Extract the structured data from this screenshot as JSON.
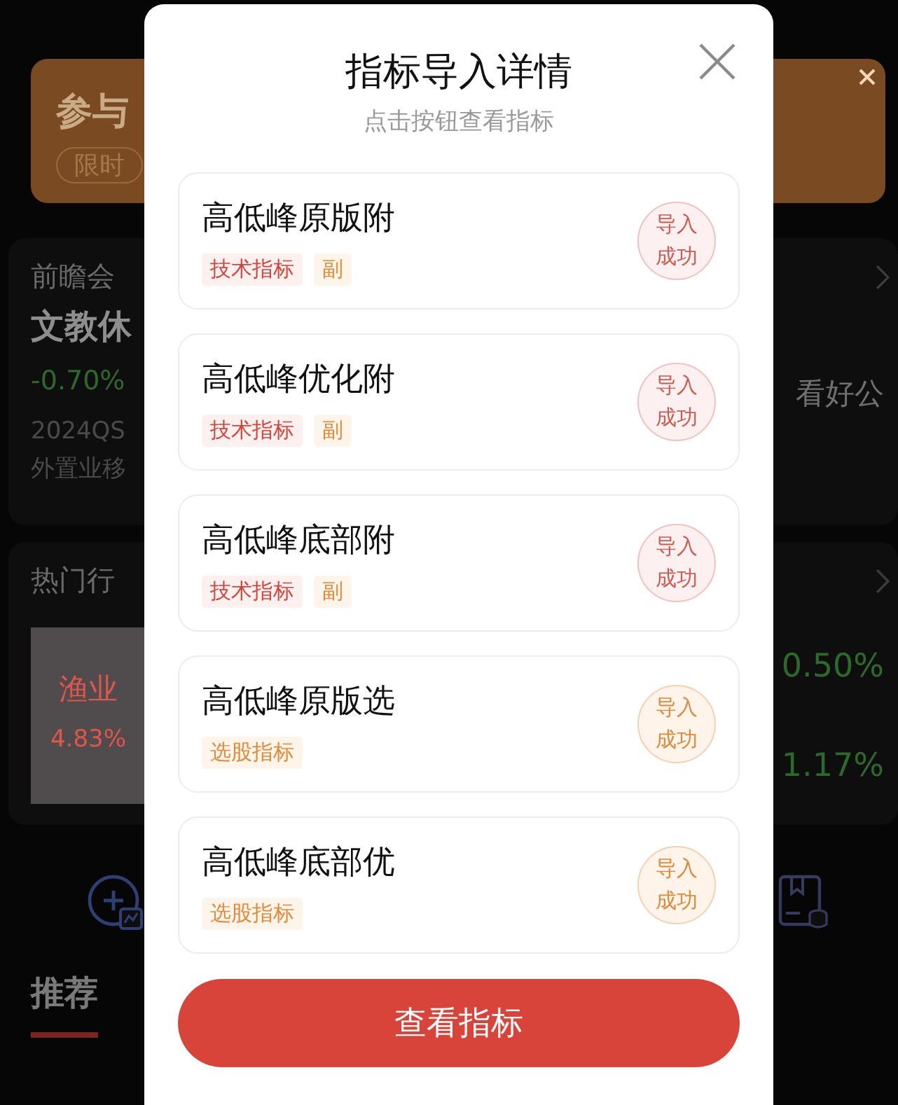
{
  "background": {
    "banner": {
      "title": "参与",
      "tag": "限时"
    },
    "meeting_card": {
      "heading": "前瞻会",
      "name": "文教休",
      "change": "-0.70%",
      "note": "看好公",
      "lines": [
        "2024QS",
        "外置业移"
      ]
    },
    "industry_card": {
      "heading": "热门行",
      "tile": {
        "name": "渔业",
        "change": "4.83%"
      },
      "changes": [
        "0.50%",
        "1.17%"
      ]
    },
    "tabs": [
      {
        "label": "推荐",
        "selected": true
      }
    ]
  },
  "dialog": {
    "title": "指标导入详情",
    "subtitle": "点击按钮查看指标",
    "items": [
      {
        "name": "高低峰原版附",
        "kind": "technical",
        "tags": [
          {
            "label": "技术指标",
            "kind": "technical"
          },
          {
            "label": "副",
            "kind": "position"
          }
        ],
        "status": "导入成功"
      },
      {
        "name": "高低峰优化附",
        "kind": "technical",
        "tags": [
          {
            "label": "技术指标",
            "kind": "technical"
          },
          {
            "label": "副",
            "kind": "position"
          }
        ],
        "status": "导入成功"
      },
      {
        "name": "高低峰底部附",
        "kind": "technical",
        "tags": [
          {
            "label": "技术指标",
            "kind": "technical"
          },
          {
            "label": "副",
            "kind": "position"
          }
        ],
        "status": "导入成功"
      },
      {
        "name": "高低峰原版选",
        "kind": "screening",
        "tags": [
          {
            "label": "选股指标",
            "kind": "screening"
          }
        ],
        "status": "导入成功"
      },
      {
        "name": "高低峰底部优",
        "kind": "screening",
        "tags": [
          {
            "label": "选股指标",
            "kind": "screening"
          }
        ],
        "status": "导入成功"
      }
    ],
    "button": "查看指标"
  }
}
